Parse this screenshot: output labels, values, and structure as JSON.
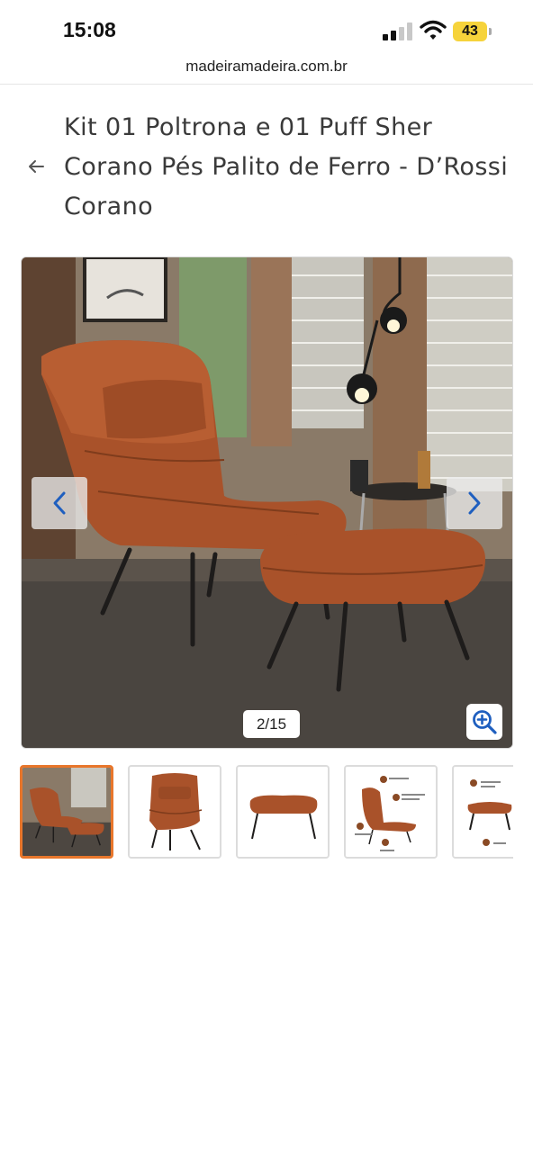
{
  "status_bar": {
    "time": "15:08",
    "battery_level": "43",
    "battery_color": "#f6d33b",
    "icons": [
      "signal-icon",
      "wifi-icon",
      "battery-icon"
    ]
  },
  "browser": {
    "url": "madeiramadeira.com.br"
  },
  "product": {
    "title": "Kit 01 Poltrona e 01 Puff Sher Corano Pés Palito de Ferro - D’Rossi Corano"
  },
  "gallery": {
    "counter": "2/15",
    "current_index": 2,
    "total": 15,
    "accent_color": "#e8762b",
    "icons": {
      "prev": "chevron-left-icon",
      "next": "chevron-right-icon",
      "zoom": "zoom-in-icon",
      "back": "arrow-left-icon"
    },
    "thumbnails": [
      {
        "name": "thumbnail-room-scene",
        "active": true
      },
      {
        "name": "thumbnail-armchair",
        "active": false
      },
      {
        "name": "thumbnail-puff",
        "active": false
      },
      {
        "name": "thumbnail-measures",
        "active": false
      },
      {
        "name": "thumbnail-details",
        "active": false
      }
    ]
  }
}
